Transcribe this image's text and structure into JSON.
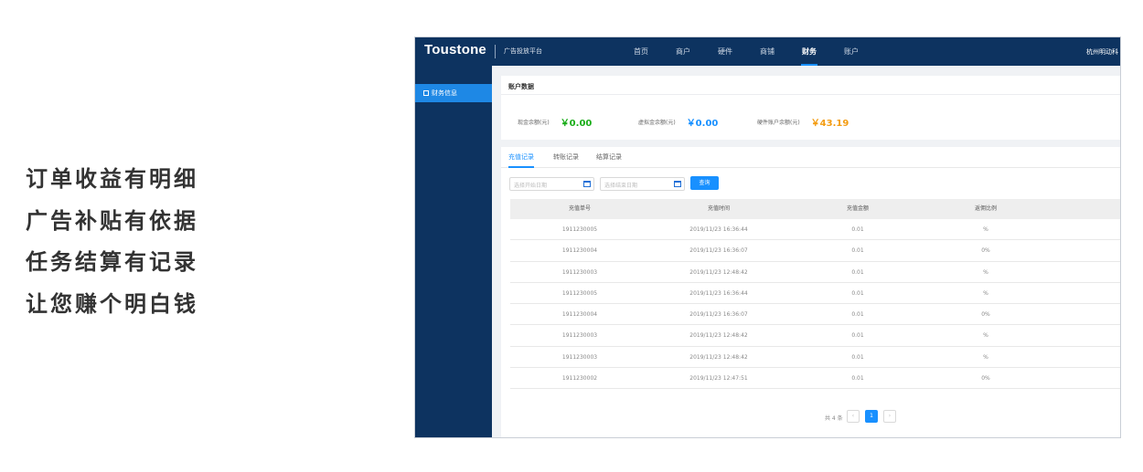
{
  "slogans": [
    "订单收益有明细",
    "广告补贴有依据",
    "任务结算有记录",
    "让您赚个明白钱"
  ],
  "header": {
    "logo": "Toustone",
    "platform": "广告投放平台",
    "nav": [
      "首页",
      "商户",
      "硬件",
      "商铺",
      "财务",
      "账户"
    ],
    "active_nav": "财务",
    "company": "杭州明动科"
  },
  "sidebar": {
    "items": [
      {
        "label": "财务信息",
        "active": true
      }
    ]
  },
  "account": {
    "title": "账户数据",
    "balances": [
      {
        "label": "现金余额(元)",
        "value": "￥0.00",
        "color": "#1aad19"
      },
      {
        "label": "虚拟金余额(元)",
        "value": "￥0.00",
        "color": "#1890ff"
      },
      {
        "label": "硬件账户余额(元)",
        "value": "￥43.19",
        "color": "#f39c12"
      }
    ]
  },
  "tabs": {
    "items": [
      "充值记录",
      "转账记录",
      "结算记录"
    ],
    "active": "充值记录"
  },
  "filters": {
    "start_placeholder": "选择开始日期",
    "end_placeholder": "选择结束日期",
    "search_label": "查询"
  },
  "table": {
    "columns": [
      "充值单号",
      "充值时间",
      "充值金额",
      "返佣比例"
    ],
    "rows": [
      [
        "1911230005",
        "2019/11/23 16:36:44",
        "0.01",
        "%"
      ],
      [
        "1911230004",
        "2019/11/23 16:36:07",
        "0.01",
        "0%"
      ],
      [
        "1911230003",
        "2019/11/23 12:48:42",
        "0.01",
        "%"
      ],
      [
        "1911230005",
        "2019/11/23 16:36:44",
        "0.01",
        "%"
      ],
      [
        "1911230004",
        "2019/11/23 16:36:07",
        "0.01",
        "0%"
      ],
      [
        "1911230003",
        "2019/11/23 12:48:42",
        "0.01",
        "%"
      ],
      [
        "1911230003",
        "2019/11/23 12:48:42",
        "0.01",
        "%"
      ],
      [
        "1911230002",
        "2019/11/23 12:47:51",
        "0.01",
        "0%"
      ]
    ]
  },
  "pagination": {
    "total_label": "共 4 条",
    "prev": "‹",
    "current": "1",
    "next": "›"
  }
}
